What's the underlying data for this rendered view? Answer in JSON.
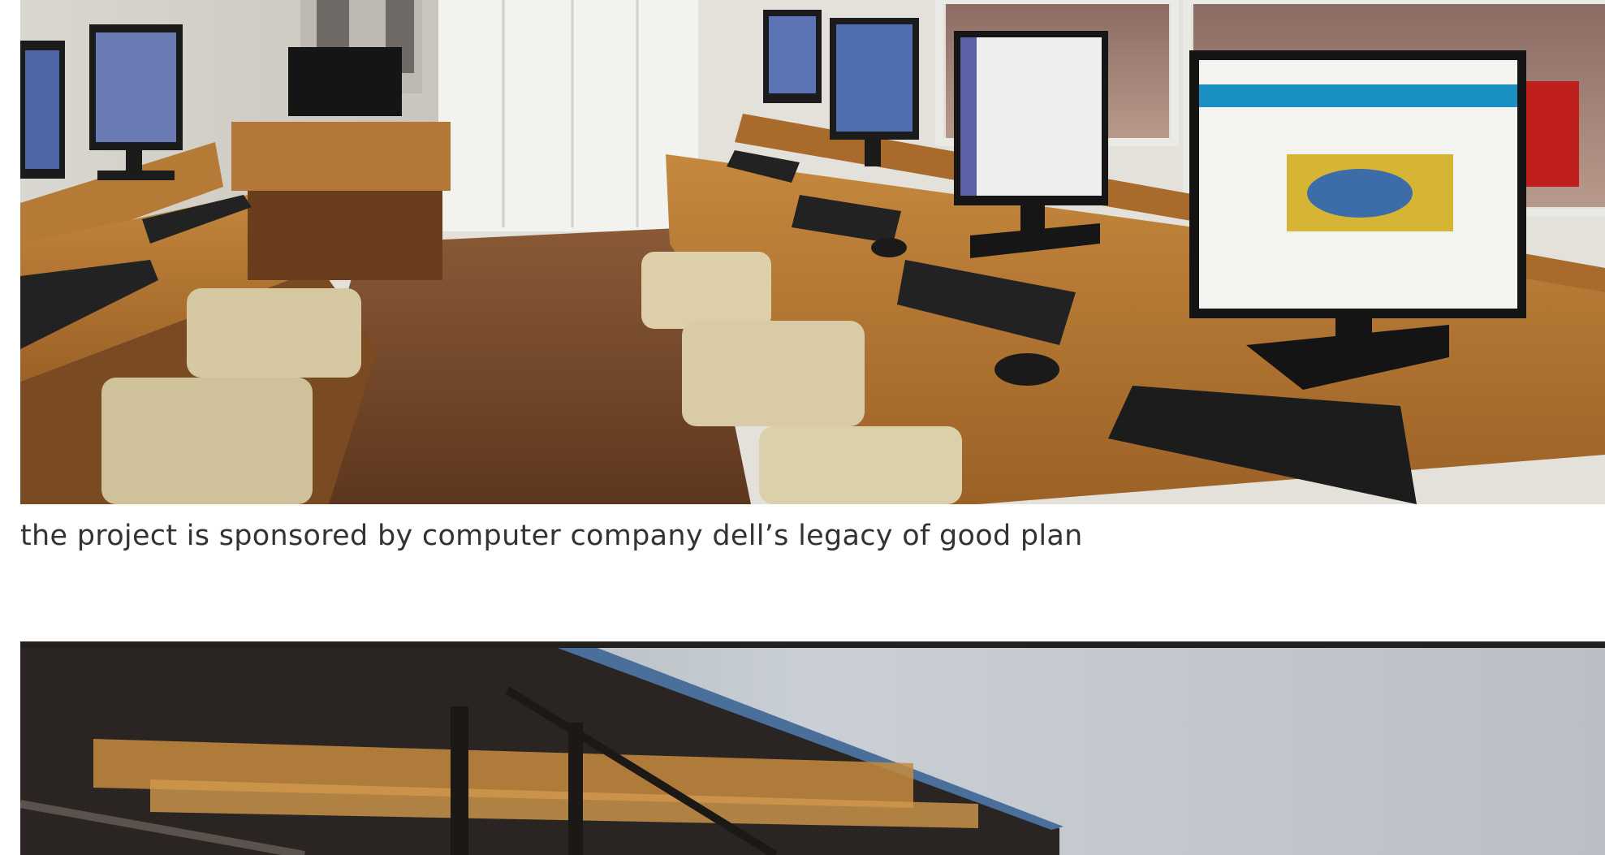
{
  "article": {
    "figures": [
      {
        "alt": "",
        "caption": "the project is sponsored by computer company dell’s legacy of good plan"
      },
      {
        "alt": "",
        "caption": ""
      }
    ]
  },
  "colors": {
    "background": "#ffffff",
    "caption_text": "#333333",
    "wood": "#a8692a",
    "floor": "#6e4226",
    "cushion": "#d8cba6",
    "screen_blue": "#1a8fc2",
    "sky": "#c9cfd4"
  }
}
